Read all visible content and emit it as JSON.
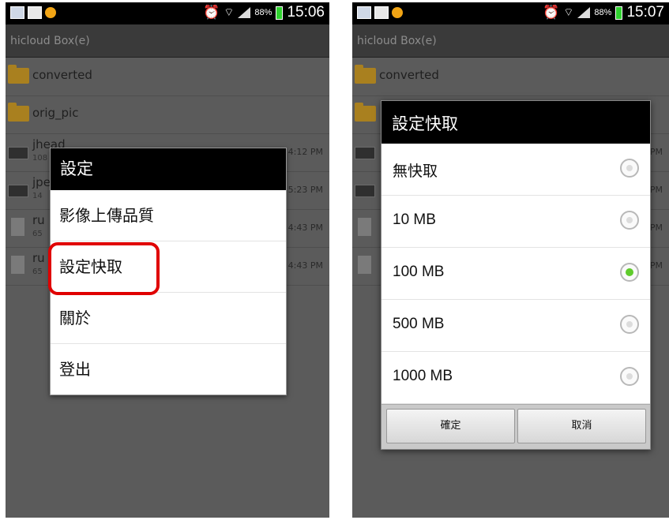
{
  "left": {
    "statusbar": {
      "battery_pct": "88%",
      "time": "15:06"
    },
    "title": "hicloud Box(e)",
    "files": [
      {
        "name": "converted",
        "kind": "folder"
      },
      {
        "name": "orig_pic",
        "kind": "folder"
      },
      {
        "name": "jhead",
        "size": "108",
        "date": "08/17/20 4:12 PM",
        "kind": "exe"
      },
      {
        "name": "jpe",
        "size": "14",
        "date": "5:23 PM",
        "kind": "exe"
      },
      {
        "name": "ru",
        "size": "65",
        "date": "4:43 PM",
        "kind": "doc"
      },
      {
        "name": "ru",
        "size": "65",
        "date": "4:43 PM",
        "kind": "doc"
      }
    ],
    "menu": {
      "title": "設定",
      "items": [
        "影像上傳品質",
        "設定快取",
        "關於",
        "登出"
      ]
    }
  },
  "right": {
    "statusbar": {
      "battery_pct": "88%",
      "time": "15:07"
    },
    "title": "hicloud Box(e)",
    "files": [
      {
        "name": "converted",
        "kind": "folder"
      },
      {
        "name": "",
        "kind": "folder"
      },
      {
        "name": "",
        "date": "PM",
        "kind": "exe"
      },
      {
        "name": "",
        "date": "PM",
        "kind": "exe"
      },
      {
        "name": "",
        "date": "PM",
        "kind": "doc"
      },
      {
        "name": "",
        "date": "PM",
        "kind": "doc"
      }
    ],
    "cache_dialog": {
      "title": "設定快取",
      "options": [
        "無快取",
        "10 MB",
        "100 MB",
        "500 MB",
        "1000 MB"
      ],
      "selected_index": 2,
      "ok_label": "確定",
      "cancel_label": "取消"
    }
  }
}
